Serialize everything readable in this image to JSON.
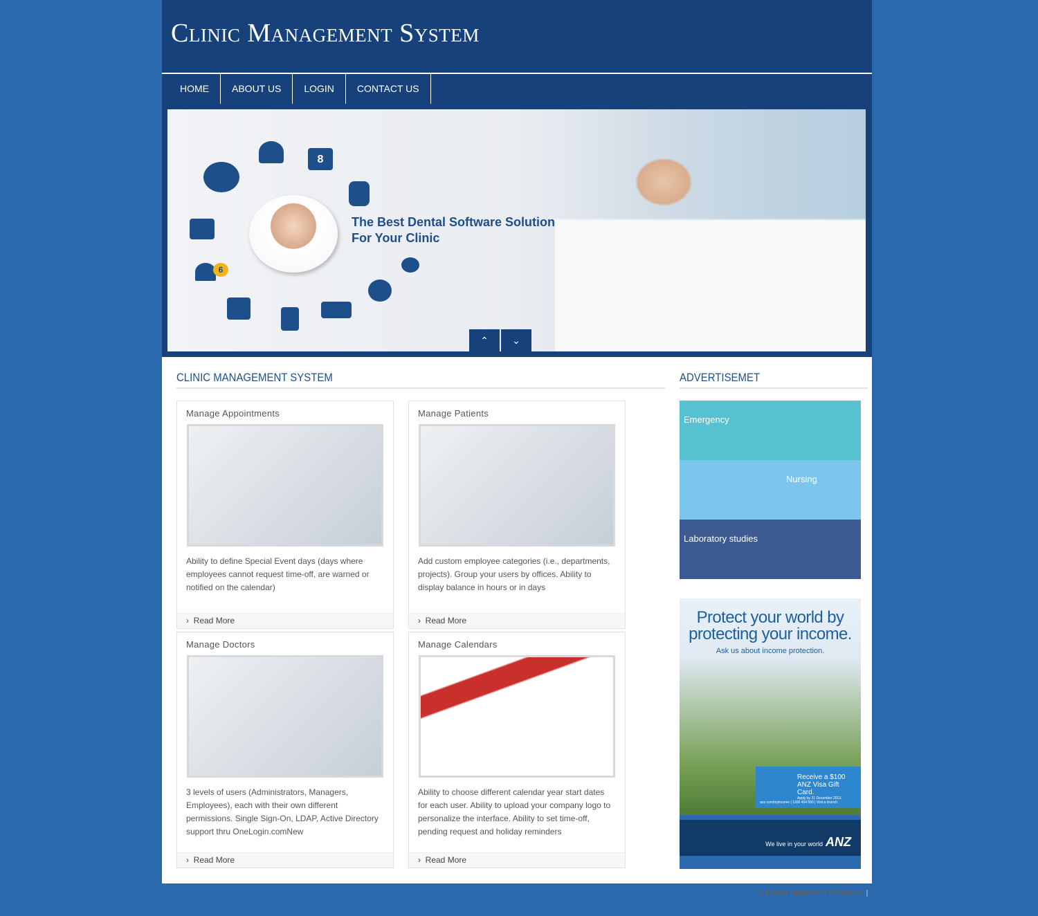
{
  "header": {
    "title": "Clinic Management System"
  },
  "nav": [
    {
      "label": "HOME"
    },
    {
      "label": "ABOUT US"
    },
    {
      "label": "LOGIN"
    },
    {
      "label": "CONTACT US"
    }
  ],
  "slider": {
    "slogan_line1": "The Best Dental Software Solution",
    "slogan_line2": "For Your Clinic",
    "badge": "6",
    "calendar_day": "8",
    "prev_icon": "chevron-up-icon",
    "next_icon": "chevron-down-icon"
  },
  "main": {
    "title": "CLINIC MANAGEMENT SYSTEM",
    "cards": [
      {
        "title": "Manage Appointments",
        "text": "Ability to define Special Event days (days where employees cannot request time-off, are warned or notified on the calendar)",
        "more": "Read More"
      },
      {
        "title": "Manage Patients",
        "text": "Add custom employee categories (i.e., departments, projects). Group your users by offices. Ability to display balance in hours or in days",
        "more": "Read More"
      },
      {
        "title": "Manage Doctors",
        "text": "3 levels of users (Administrators, Managers, Employees), each with their own different permissions. Single Sign-On, LDAP, Active Directory support thru OneLogin.comNew",
        "more": "Read More"
      },
      {
        "title": "Manage Calendars",
        "text": "Ability to choose different calendar year start dates for each user. Ability to upload your company logo to personalize the interface. Ability to set time-off, pending request and holiday reminders",
        "more": "Read More"
      }
    ]
  },
  "sidebar": {
    "title": "ADVERTISEMET",
    "ad1": [
      {
        "label": "Emergency",
        "color": "#56c1cf"
      },
      {
        "label": "Nursing",
        "color": "#7cc6ee"
      },
      {
        "label": "Laboratory studies",
        "color": "#3e5a92"
      }
    ],
    "ad2": {
      "headline": "Protect your world by protecting your income.",
      "sub": "Ask us about income protection.",
      "gift_line1": "Receive a $100",
      "gift_line2": "ANZ Visa Gift Card.",
      "gift_apply": "Apply by 31 December 2013.",
      "gift_contact": "anz.com/myincome | 1300 464 500 | Visit a branch",
      "tagline": "We live in your world",
      "brand": "ANZ"
    }
  },
  "footer": {
    "copyright": "© Doctor Appointment System",
    "sep": "|"
  }
}
